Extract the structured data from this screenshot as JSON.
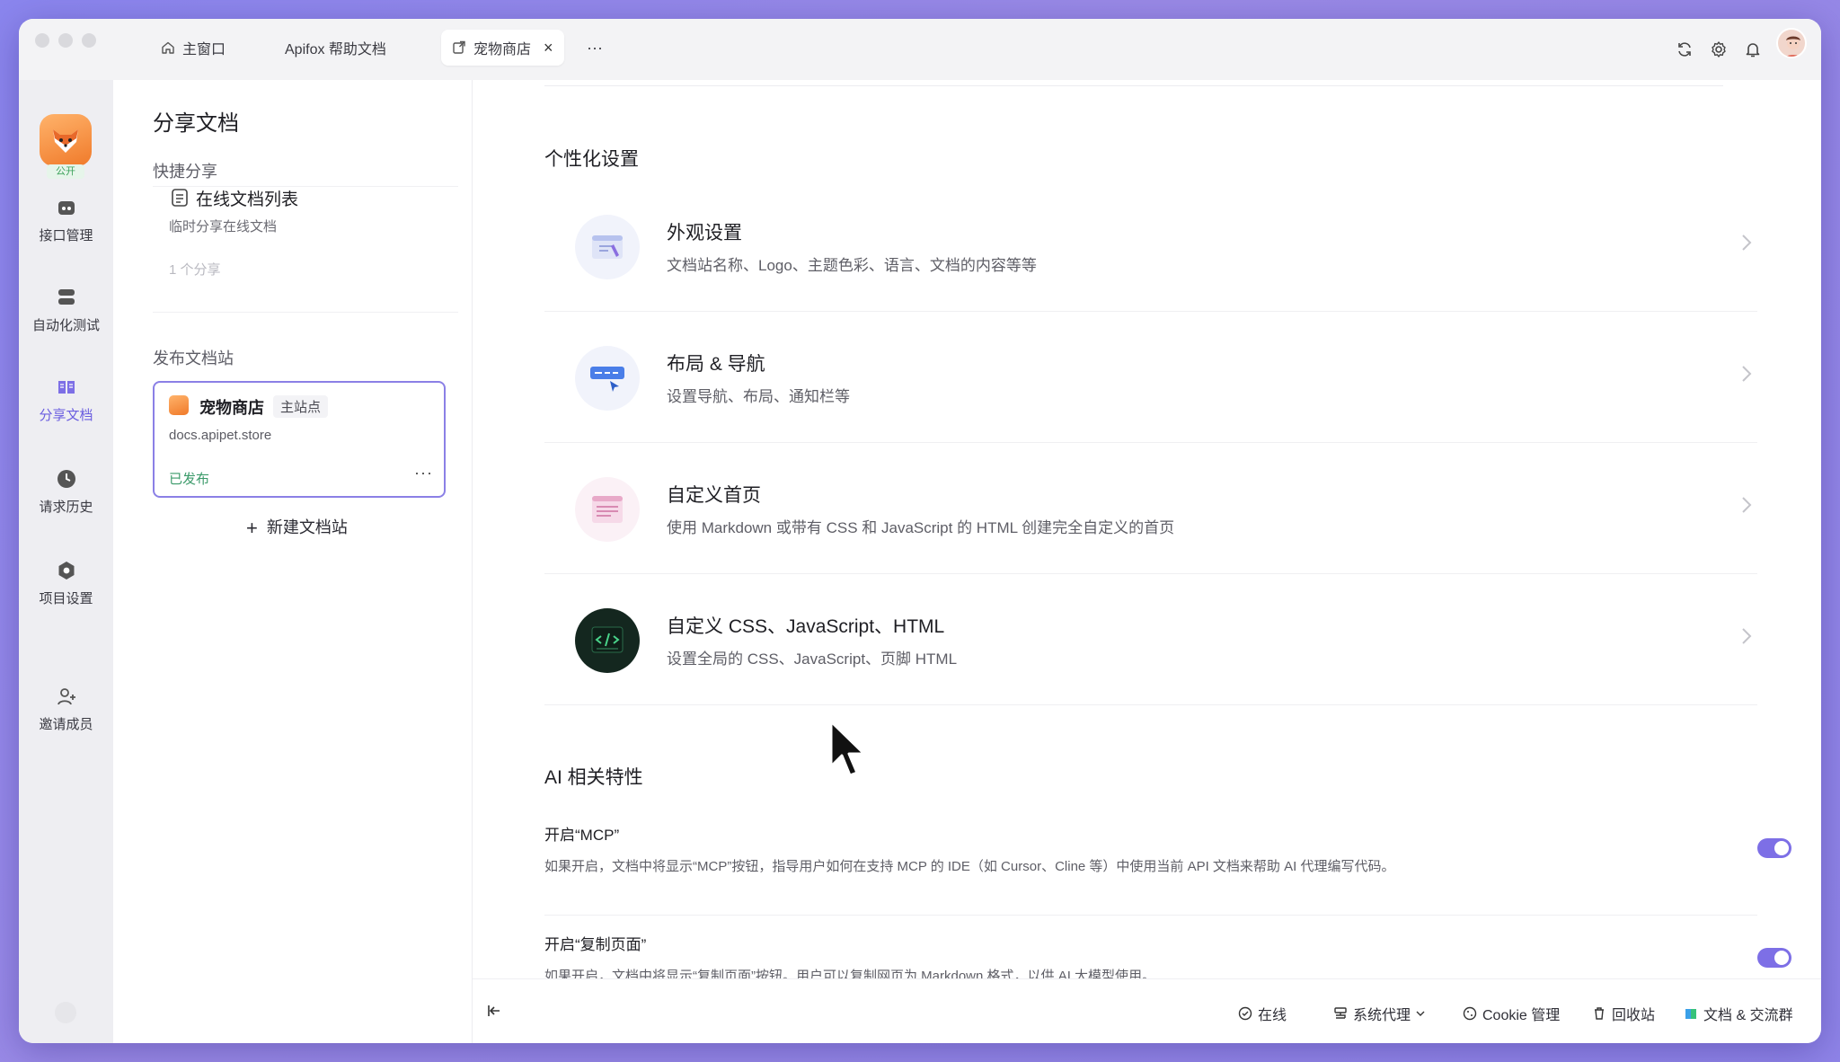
{
  "tabs": [
    {
      "label": "主窗口",
      "icon": "home-icon"
    },
    {
      "label": "Apifox 帮助文档",
      "icon": ""
    },
    {
      "label": "宠物商店",
      "icon": "share-doc-icon",
      "active": true
    }
  ],
  "tab_overflow": "···",
  "rail": {
    "public_badge": "公开",
    "items": [
      {
        "label": "接口管理",
        "icon": "api-icon"
      },
      {
        "label": "自动化测试",
        "icon": "test-icon"
      },
      {
        "label": "分享文档",
        "icon": "book-icon",
        "active": true
      },
      {
        "label": "请求历史",
        "icon": "clock-icon"
      },
      {
        "label": "项目设置",
        "icon": "settings-icon"
      },
      {
        "label": "邀请成员",
        "icon": "invite-icon"
      }
    ]
  },
  "panel": {
    "title": "分享文档",
    "quick_share_label": "快捷分享",
    "quick_card": {
      "title": "在线文档列表",
      "subtitle": "临时分享在线文档",
      "count": "1 个分享"
    },
    "publish_label": "发布文档站",
    "site_card": {
      "name": "宠物商店",
      "tag": "主站点",
      "url": "docs.apipet.store",
      "status": "已发布",
      "more": "···"
    },
    "new_site_label": "新建文档站",
    "new_site_plus": "+"
  },
  "main": {
    "personalization_heading": "个性化设置",
    "settings": [
      {
        "title": "外观设置",
        "desc": "文档站名称、Logo、主题色彩、语言、文档的内容等等",
        "icon": "appearance-icon"
      },
      {
        "title": "布局 & 导航",
        "desc": "设置导航、布局、通知栏等",
        "icon": "layout-icon"
      },
      {
        "title": "自定义首页",
        "desc": "使用 Markdown 或带有 CSS 和 JavaScript 的 HTML 创建完全自定义的首页",
        "icon": "homepage-icon"
      },
      {
        "title": "自定义 CSS、JavaScript、HTML",
        "desc": "设置全局的 CSS、JavaScript、页脚 HTML",
        "icon": "code-icon"
      }
    ],
    "ai_heading": "AI 相关特性",
    "toggles": [
      {
        "title": "开启“MCP”",
        "desc": "如果开启，文档中将显示“MCP”按钮，指导用户如何在支持 MCP 的 IDE（如 Cursor、Cline 等）中使用当前 API 文档来帮助 AI 代理编写代码。",
        "on": true
      },
      {
        "title": "开启“复制页面”",
        "desc": "如果开启，文档中将显示“复制页面”按钮。用户可以复制网页为 Markdown 格式，以供 AI 大模型使用。",
        "on": true
      }
    ]
  },
  "statusbar": {
    "online": "在线",
    "proxy": "系统代理",
    "cookie": "Cookie 管理",
    "recycle": "回收站",
    "docs": "文档 & 交流群"
  },
  "colors": {
    "accent": "#7d6fe6",
    "success": "#3b9a6a",
    "background": "#8f86e8"
  }
}
